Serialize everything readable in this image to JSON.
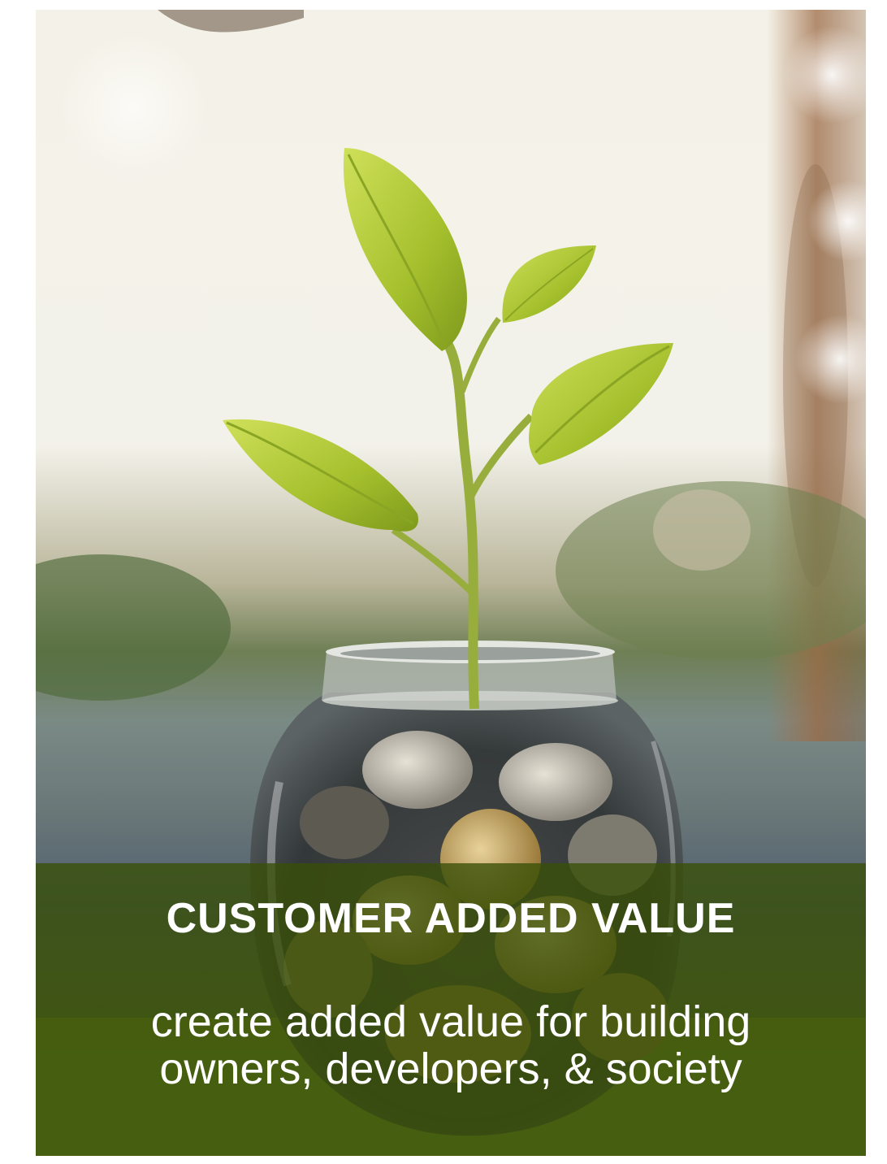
{
  "card": {
    "title": "CUSTOMER ADDED VALUE",
    "subtitle_line1": "create added value for building",
    "subtitle_line2": "owners, developers, & society",
    "image": "seedling-growing-from-glass-jar-of-coins"
  },
  "colors": {
    "caption_overlay": "#385006",
    "leaf": "#a7c22f",
    "text": "#ffffff"
  }
}
